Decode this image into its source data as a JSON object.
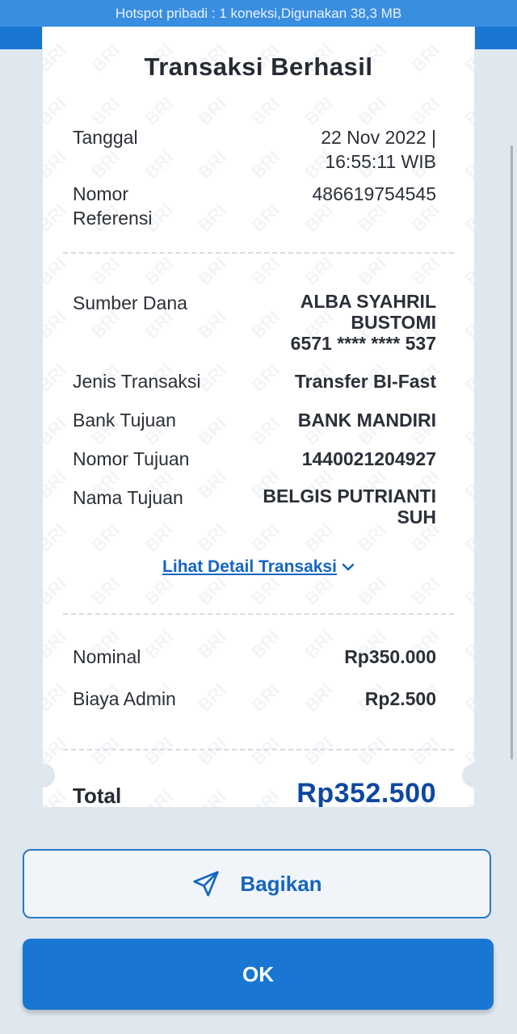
{
  "status_bar": {
    "text": "Hotspot pribadi : 1 koneksi,Digunakan 38,3 MB"
  },
  "receipt": {
    "title": "Transaksi Berhasil",
    "watermark": "BRI",
    "tanggal": {
      "label": "Tanggal",
      "value_line1": "22 Nov 2022 |",
      "value_line2": "16:55:11 WIB"
    },
    "nomor_referensi": {
      "label_line1": "Nomor",
      "label_line2": "Referensi",
      "value": "486619754545"
    },
    "sumber_dana": {
      "label": "Sumber Dana",
      "value_line1": "ALBA SYAHRIL",
      "value_line2": "BUSTOMI",
      "value_line3": "6571 **** **** 537"
    },
    "jenis_transaksi": {
      "label": "Jenis Transaksi",
      "value": "Transfer BI-Fast"
    },
    "bank_tujuan": {
      "label": "Bank Tujuan",
      "value": "BANK MANDIRI"
    },
    "nomor_tujuan": {
      "label": "Nomor Tujuan",
      "value": "1440021204927"
    },
    "nama_tujuan": {
      "label": "Nama Tujuan",
      "value_line1": "BELGIS PUTRIANTI",
      "value_line2": "SUH"
    },
    "detail_link": "Lihat Detail Transaksi",
    "nominal": {
      "label": "Nominal",
      "value": "Rp350.000"
    },
    "biaya_admin": {
      "label": "Biaya Admin",
      "value": "Rp2.500"
    },
    "total": {
      "label": "Total",
      "value": "Rp352.500"
    }
  },
  "actions": {
    "share_label": "Bagikan",
    "ok_label": "OK"
  },
  "icons": {
    "share": "send-icon",
    "detail": "chevron-down-icon"
  },
  "colors": {
    "primary": "#1976d2",
    "link": "#1565c0",
    "total": "#0d47a1"
  }
}
